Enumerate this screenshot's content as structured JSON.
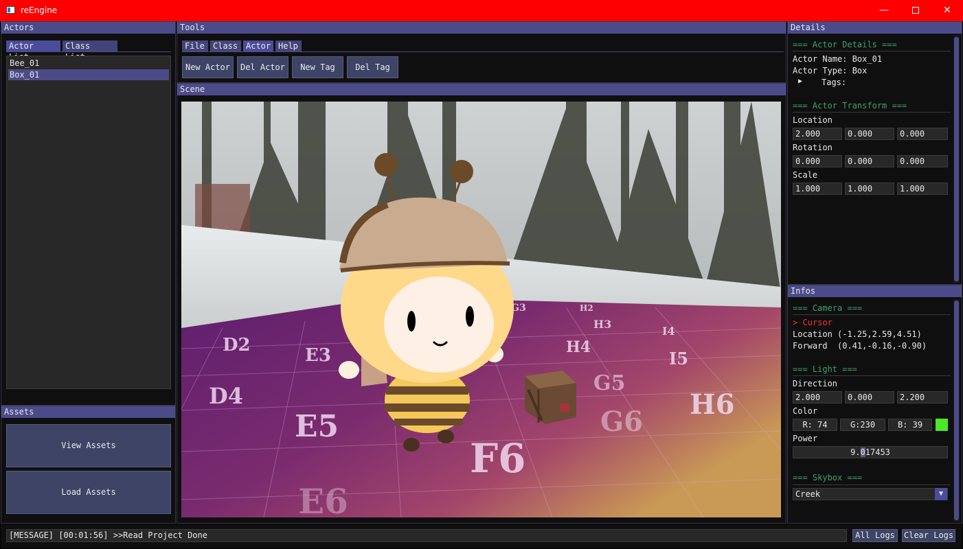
{
  "window": {
    "title": "reEngine",
    "minimize_glyph": "—",
    "close_glyph": "✕"
  },
  "actors": {
    "title": "Actors",
    "tabs": [
      "Actor List",
      "Class List"
    ],
    "items": [
      "Bee_01",
      "Box_01"
    ],
    "selected_index": 1
  },
  "assets": {
    "title": "Assets",
    "view_label": "View Assets",
    "load_label": "Load Assets"
  },
  "tools": {
    "title": "Tools",
    "menus": [
      "File",
      "Class",
      "Actor",
      "Help"
    ],
    "buttons": [
      "New Actor",
      "Del Actor",
      "New Tag",
      "Del Tag"
    ]
  },
  "scene": {
    "title": "Scene",
    "tile_labels": [
      "D2",
      "E3",
      "D4",
      "E5",
      "F6",
      "E6",
      "G6",
      "H6",
      "H4",
      "I5",
      "G5",
      "G3",
      "H3",
      "H2",
      "I4"
    ]
  },
  "details": {
    "title": "Details",
    "actor_details_header": "=== Actor Details ===",
    "actor_name": "Actor Name: Box_01",
    "actor_type": "Actor Type: Box",
    "tags_arrow": "▶",
    "tags_label": "Tags:",
    "transform_header": "=== Actor Transform ===",
    "location_label": "Location",
    "location": [
      "2.000",
      "0.000",
      "0.000"
    ],
    "rotation_label": "Rotation",
    "rotation": [
      "0.000",
      "0.000",
      "0.000"
    ],
    "scale_label": "Scale",
    "scale": [
      "1.000",
      "1.000",
      "1.000"
    ]
  },
  "infos": {
    "title": "Infos",
    "camera_header": "=== Camera ===",
    "cursor": "> Cursor",
    "location": "Location (-1.25,2.59,4.51)",
    "forward": "Forward  (0.41,-0.16,-0.90)",
    "light_header": "=== Light ===",
    "direction_label": "Direction",
    "direction": [
      "2.000",
      "0.000",
      "2.200"
    ],
    "color_label": "Color",
    "color_r": "R: 74",
    "color_g": "G:230",
    "color_b": "B: 39",
    "color_swatch": "#4ae627",
    "power_label": "Power",
    "power": "9.017453",
    "skybox_header": "=== Skybox ===",
    "skybox_value": "Creek",
    "dropdown_arrow": "▼"
  },
  "status": {
    "message": "[MESSAGE] [00:01:56] >>Read Project Done",
    "all_logs": "All Logs",
    "clear_logs": "Clear Logs"
  },
  "colors": {
    "titlebar": "#ff0000",
    "panel_header": "#4b4b8a",
    "section_header": "#3fa06a",
    "cursor": "#ff3030"
  }
}
